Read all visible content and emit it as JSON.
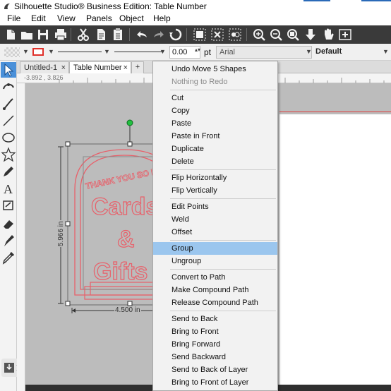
{
  "window": {
    "title": "Silhouette Studio® Business Edition: Table Number"
  },
  "menubar": {
    "items": [
      "File",
      "Edit",
      "View",
      "Panels",
      "Object",
      "Help"
    ]
  },
  "toolbar": {
    "icons": [
      "new-file",
      "open-folder",
      "save",
      "print",
      "cut",
      "copy",
      "paste",
      "undo",
      "redo",
      "rotate",
      "group",
      "ungroup",
      "replicate",
      "zoom-in",
      "zoom-out",
      "zoom-fit",
      "pan-down",
      "hand",
      "add-page"
    ]
  },
  "properties": {
    "line_width": "0.00",
    "line_unit": "pt",
    "font": "Arial",
    "font_style": "Default",
    "line_color": "#e0302a"
  },
  "tabs": [
    {
      "label": "Untitled-1",
      "close": "×"
    },
    {
      "label": "Table Number",
      "close": "×"
    },
    {
      "label": "+"
    }
  ],
  "ruler": {
    "coordinates": "-3.892 , 3.826"
  },
  "design": {
    "line1": "THANK YOU SO MUCH",
    "line2": "Cards",
    "line3": "&",
    "line4": "Gifts",
    "height_label": "5.966 in",
    "width_label": "4.500 in",
    "stroke_color": "#e8606a"
  },
  "context_menu": {
    "items": [
      {
        "label": "Undo Move 5 Shapes",
        "enabled": true
      },
      {
        "label": "Nothing to Redo",
        "enabled": false
      },
      {
        "sep": true
      },
      {
        "label": "Cut",
        "enabled": true
      },
      {
        "label": "Copy",
        "enabled": true
      },
      {
        "label": "Paste",
        "enabled": true
      },
      {
        "label": "Paste in Front",
        "enabled": true
      },
      {
        "label": "Duplicate",
        "enabled": true
      },
      {
        "label": "Delete",
        "enabled": true
      },
      {
        "sep": true
      },
      {
        "label": "Flip Horizontally",
        "enabled": true
      },
      {
        "label": "Flip Vertically",
        "enabled": true
      },
      {
        "sep": true
      },
      {
        "label": "Edit Points",
        "enabled": true
      },
      {
        "label": "Weld",
        "enabled": true
      },
      {
        "label": "Offset",
        "enabled": true
      },
      {
        "sep": true
      },
      {
        "label": "Group",
        "enabled": true,
        "highlighted": true
      },
      {
        "label": "Ungroup",
        "enabled": true
      },
      {
        "sep": true
      },
      {
        "label": "Convert to Path",
        "enabled": true
      },
      {
        "label": "Make Compound Path",
        "enabled": true
      },
      {
        "label": "Release Compound Path",
        "enabled": true
      },
      {
        "sep": true
      },
      {
        "label": "Send to Back",
        "enabled": true
      },
      {
        "label": "Bring to Front",
        "enabled": true
      },
      {
        "label": "Bring Forward",
        "enabled": true
      },
      {
        "label": "Send Backward",
        "enabled": true
      },
      {
        "label": "Send to Back of Layer",
        "enabled": true
      },
      {
        "label": "Bring to Front of Layer",
        "enabled": true
      }
    ]
  }
}
